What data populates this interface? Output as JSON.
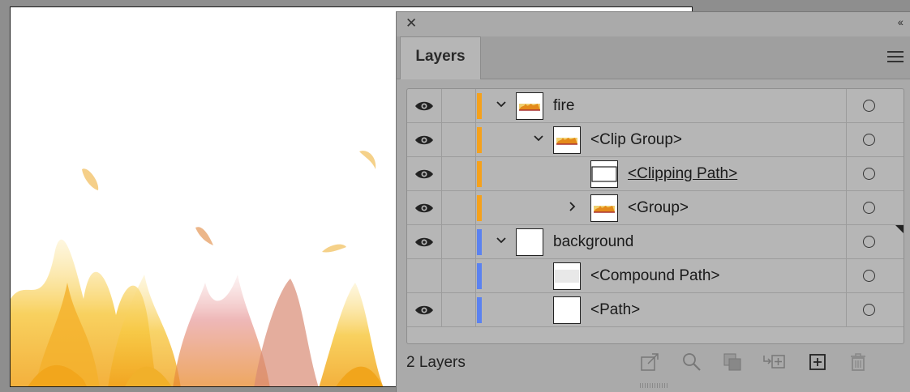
{
  "panel": {
    "tab_label": "Layers",
    "close_glyph": "✕",
    "collapse_glyph": "‹‹",
    "layer_count": "2 Layers"
  },
  "layers": [
    {
      "name": "fire",
      "visible": true,
      "color": "#f5a11c",
      "indent": 0,
      "expander": "open",
      "thumb": "fire",
      "underline": false,
      "selected_marker": false
    },
    {
      "name": "<Clip Group>",
      "visible": true,
      "color": "#f5a11c",
      "indent": 1,
      "expander": "open",
      "thumb": "fire",
      "underline": false,
      "selected_marker": false
    },
    {
      "name": "<Clipping Path>",
      "visible": true,
      "color": "#f5a11c",
      "indent": 2,
      "expander": "none",
      "thumb": "rect",
      "underline": true,
      "selected_marker": false
    },
    {
      "name": "<Group>",
      "visible": true,
      "color": "#f5a11c",
      "indent": 2,
      "expander": "closed",
      "thumb": "fire",
      "underline": false,
      "selected_marker": false
    },
    {
      "name": "background",
      "visible": true,
      "color": "#5b82f0",
      "indent": 0,
      "expander": "open",
      "thumb": "blank",
      "underline": false,
      "selected_marker": true
    },
    {
      "name": "<Compound Path>",
      "visible": false,
      "color": "#5b82f0",
      "indent": 1,
      "expander": "none",
      "thumb": "light",
      "underline": false,
      "selected_marker": false
    },
    {
      "name": "<Path>",
      "visible": true,
      "color": "#5b82f0",
      "indent": 1,
      "expander": "none",
      "thumb": "blank",
      "underline": false,
      "selected_marker": false
    }
  ],
  "footer_icons": [
    "export-icon",
    "locate-icon",
    "clipping-mask-icon",
    "sublayer-icon",
    "new-layer-icon",
    "trash-icon"
  ]
}
